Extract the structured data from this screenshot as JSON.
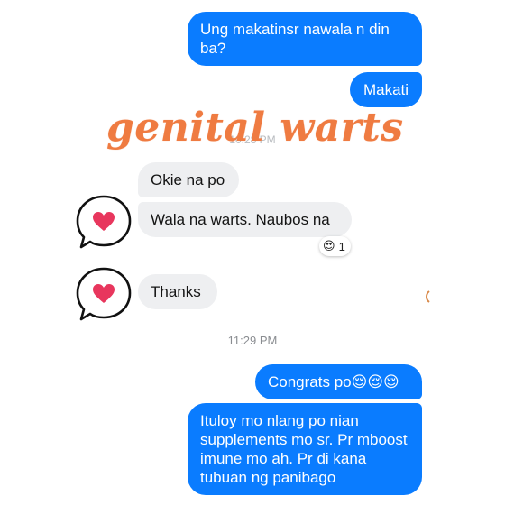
{
  "watermark": "genital warts",
  "timestamps": {
    "faded": "10:28 PM",
    "main": "11:29 PM"
  },
  "messages": [
    {
      "id": "m1",
      "sender": "me",
      "text": "Ung makatinsr nawala n din ba?"
    },
    {
      "id": "m2",
      "sender": "me",
      "text": "Makati"
    },
    {
      "id": "m3",
      "sender": "them",
      "text": "Okie na po"
    },
    {
      "id": "m4",
      "sender": "them",
      "text": "Wala na warts. Naubos na"
    },
    {
      "id": "m5",
      "sender": "them",
      "text": "Thanks"
    },
    {
      "id": "m6",
      "sender": "me",
      "text": "Congrats po😌😌😌"
    },
    {
      "id": "m7",
      "sender": "me",
      "text": "Ituloy mo nlang po nian supplements mo sr. Pr mboost imune mo ah. Pr di kana tubuan ng panibago"
    }
  ],
  "reaction": {
    "emoji": "😍",
    "count": "1",
    "icon": "heart-eyes-emoji-icon"
  },
  "icons": {
    "speech_heart": "speech-bubble-heart-icon"
  },
  "colors": {
    "outgoing_bubble": "#0a7cff",
    "incoming_bubble": "#eeeff1",
    "watermark": "#ef7b41",
    "heart": "#e8365d",
    "timestamp": "#8a8d91"
  }
}
